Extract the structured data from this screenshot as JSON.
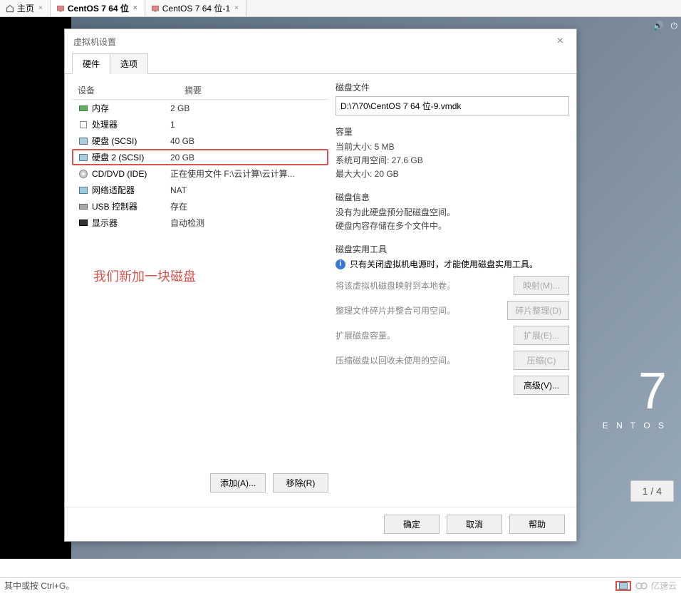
{
  "tabs": [
    {
      "label": "主页",
      "icon": "home",
      "closable": true
    },
    {
      "label": "CentOS 7 64 位",
      "icon": "vm",
      "closable": true,
      "active": true
    },
    {
      "label": "CentOS 7 64 位-1",
      "icon": "vm",
      "closable": true
    }
  ],
  "dialog": {
    "title": "虚拟机设置",
    "tabs": {
      "hardware": "硬件",
      "options": "选项"
    },
    "columns": {
      "device": "设备",
      "summary": "摘要"
    },
    "devices": [
      {
        "name": "内存",
        "summary": "2 GB",
        "icon": "mem"
      },
      {
        "name": "处理器",
        "summary": "1",
        "icon": "cpu"
      },
      {
        "name": "硬盘 (SCSI)",
        "summary": "40 GB",
        "icon": "disk"
      },
      {
        "name": "硬盘 2 (SCSI)",
        "summary": "20 GB",
        "icon": "disk",
        "selected": true
      },
      {
        "name": "CD/DVD (IDE)",
        "summary": "正在使用文件 F:\\云计算\\云计算...",
        "icon": "cd"
      },
      {
        "name": "网络适配器",
        "summary": "NAT",
        "icon": "net"
      },
      {
        "name": "USB 控制器",
        "summary": "存在",
        "icon": "usb"
      },
      {
        "name": "显示器",
        "summary": "自动检测",
        "icon": "display"
      }
    ],
    "annotation": "我们新加一块磁盘",
    "buttons": {
      "add": "添加(A)...",
      "remove": "移除(R)"
    },
    "right": {
      "disk_file_label": "磁盘文件",
      "disk_file_value": "D:\\7\\70\\CentOS 7 64 位-9.vmdk",
      "capacity_label": "容量",
      "capacity": {
        "current": "当前大小: 5 MB",
        "free": "系统可用空间: 27.6 GB",
        "max": "最大大小: 20 GB"
      },
      "info_label": "磁盘信息",
      "info_lines": [
        "没有为此硬盘预分配磁盘空间。",
        "硬盘内容存储在多个文件中。"
      ],
      "util_label": "磁盘实用工具",
      "util_note": "只有关闭虚拟机电源时，才能使用磁盘实用工具。",
      "utilities": [
        {
          "desc": "将该虚拟机磁盘映射到本地卷。",
          "btn": "映射(M)..."
        },
        {
          "desc": "整理文件碎片并整合可用空间。",
          "btn": "碎片整理(D)"
        },
        {
          "desc": "扩展磁盘容量。",
          "btn": "扩展(E)..."
        },
        {
          "desc": "压缩磁盘以回收未使用的空间。",
          "btn": "压缩(C)"
        }
      ],
      "advanced": "高级(V)..."
    },
    "footer": {
      "ok": "确定",
      "cancel": "取消",
      "help": "帮助"
    }
  },
  "desktop": {
    "brand_num": "7",
    "brand_name": "E N T O S",
    "page": "1 / 4"
  },
  "status": {
    "left": "其中或按 Ctrl+G。",
    "watermark": "亿速云"
  }
}
